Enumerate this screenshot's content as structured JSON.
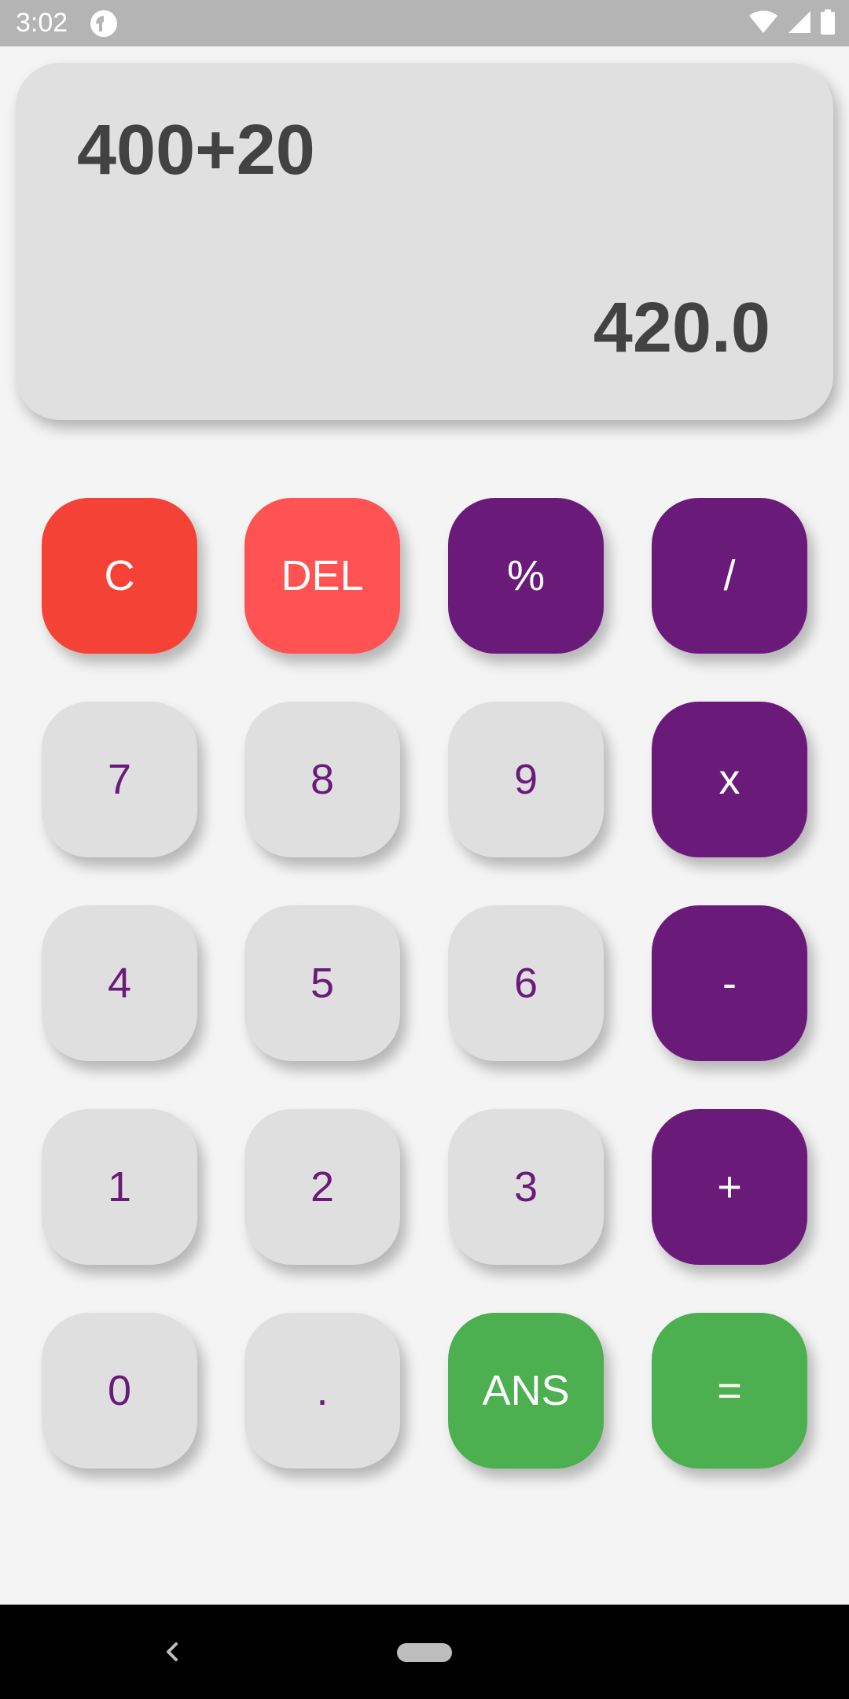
{
  "status_bar": {
    "time": "3:02",
    "app_icon": "pocket-casts-icon",
    "icons": [
      "wifi-icon",
      "signal-icon",
      "battery-icon"
    ]
  },
  "display": {
    "expression": "400+20",
    "result": "420.0"
  },
  "keypad": {
    "rows": [
      [
        {
          "label": "C",
          "type": "clear"
        },
        {
          "label": "DEL",
          "type": "del"
        },
        {
          "label": "%",
          "type": "op"
        },
        {
          "label": "/",
          "type": "op"
        }
      ],
      [
        {
          "label": "7",
          "type": "num"
        },
        {
          "label": "8",
          "type": "num"
        },
        {
          "label": "9",
          "type": "num"
        },
        {
          "label": "x",
          "type": "op"
        }
      ],
      [
        {
          "label": "4",
          "type": "num"
        },
        {
          "label": "5",
          "type": "num"
        },
        {
          "label": "6",
          "type": "num"
        },
        {
          "label": "-",
          "type": "op"
        }
      ],
      [
        {
          "label": "1",
          "type": "num"
        },
        {
          "label": "2",
          "type": "num"
        },
        {
          "label": "3",
          "type": "num"
        },
        {
          "label": "+",
          "type": "op"
        }
      ],
      [
        {
          "label": "0",
          "type": "num"
        },
        {
          "label": ".",
          "type": "num"
        },
        {
          "label": "ANS",
          "type": "green"
        },
        {
          "label": "=",
          "type": "green"
        }
      ]
    ]
  },
  "colors": {
    "accent_purple": "#6a1b7a",
    "clear_red": "#f44336",
    "delete_red": "#ff5252",
    "green": "#4caf50",
    "number_key_bg": "#e0dfe0",
    "display_bg": "#e1e0e1",
    "display_text": "#424242"
  },
  "nav_bar": {
    "icons": [
      "back-icon",
      "home-pill-icon"
    ]
  }
}
